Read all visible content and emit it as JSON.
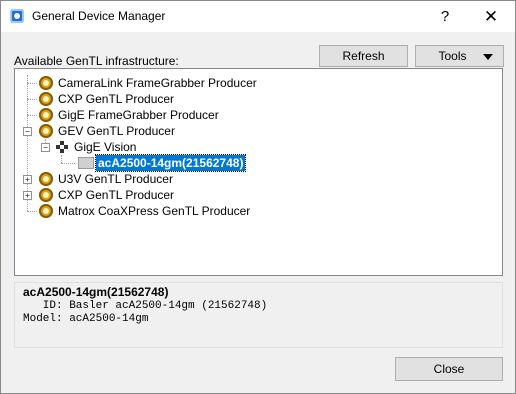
{
  "window": {
    "title": "General Device Manager",
    "help_glyph": "?",
    "close_glyph": "✕"
  },
  "toolbar": {
    "available_label": "Available GenTL infrastructure:",
    "refresh_label": "Refresh",
    "tools_label": "Tools"
  },
  "tree": {
    "items": [
      {
        "label": "CameraLink FrameGrabber Producer"
      },
      {
        "label": "CXP GenTL Producer"
      },
      {
        "label": "GigE FrameGrabber Producer"
      },
      {
        "label": "GEV GenTL Producer",
        "expander": "−"
      },
      {
        "label": "GigE Vision",
        "expander": "−"
      },
      {
        "label": "acA2500-14gm(21562748)",
        "selected": true
      },
      {
        "label": "U3V GenTL Producer",
        "expander": "+"
      },
      {
        "label": "CXP GenTL Producer",
        "expander": "+"
      },
      {
        "label": "Matrox CoaXPress GenTL Producer"
      }
    ]
  },
  "info": {
    "title": "acA2500-14gm(21562748)",
    "id_line": "   ID: Basler acA2500-14gm (21562748)",
    "model_line": "Model: acA2500-14gm"
  },
  "footer": {
    "close_label": "Close"
  },
  "colors": {
    "selection": "#0078d7",
    "gear": "#d8a21c"
  }
}
